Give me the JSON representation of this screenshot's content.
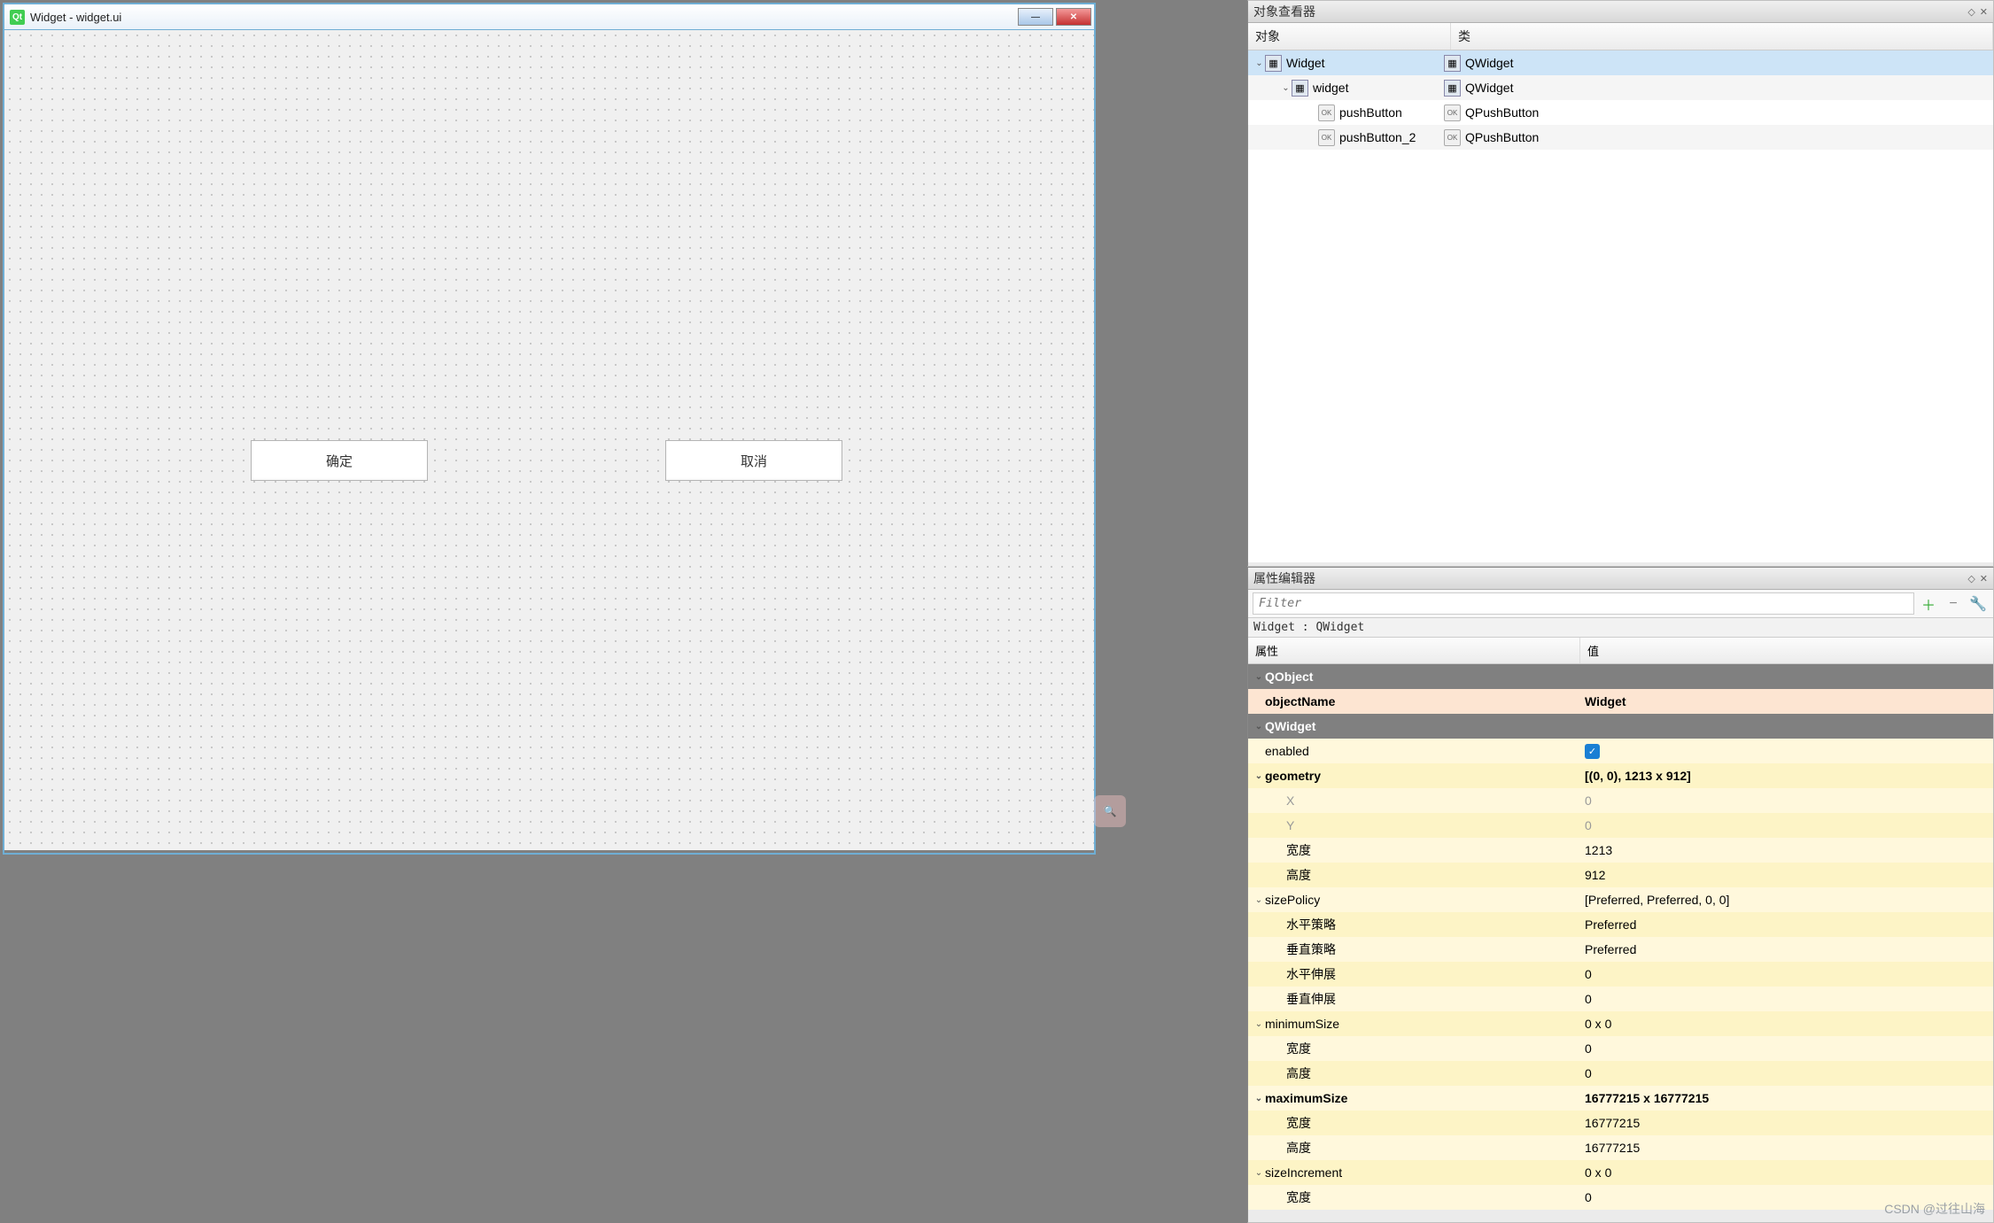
{
  "window": {
    "title": "Widget - widget.ui",
    "qt": "Qt"
  },
  "buttons": {
    "ok": "确定",
    "cancel": "取消"
  },
  "objectViewer": {
    "title": "对象查看器",
    "col1": "对象",
    "col2": "类",
    "rows": [
      {
        "name": "Widget",
        "cls": "QWidget",
        "indent": 0,
        "exp": true,
        "icon": "w",
        "sel": true
      },
      {
        "name": "widget",
        "cls": "QWidget",
        "indent": 1,
        "exp": true,
        "icon": "w",
        "alt": true
      },
      {
        "name": "pushButton",
        "cls": "QPushButton",
        "indent": 2,
        "icon": "b"
      },
      {
        "name": "pushButton_2",
        "cls": "QPushButton",
        "indent": 2,
        "icon": "b",
        "alt": true
      }
    ]
  },
  "propertyEditor": {
    "title": "属性编辑器",
    "filter": "Filter",
    "context": "Widget : QWidget",
    "col1": "属性",
    "col2": "值",
    "rows": [
      {
        "t": "g",
        "n": "QObject"
      },
      {
        "t": "p",
        "n": "objectName",
        "v": "Widget",
        "cls": "p bold",
        "ind": 1
      },
      {
        "t": "g",
        "n": "QWidget"
      },
      {
        "t": "p",
        "n": "enabled",
        "v": "",
        "chk": true,
        "cls": "y",
        "ind": 1
      },
      {
        "t": "p",
        "n": "geometry",
        "v": "[(0, 0), 1213 x 912]",
        "cls": "y2 bold",
        "ind": 1,
        "exp": true
      },
      {
        "t": "p",
        "n": "X",
        "v": "0",
        "cls": "y",
        "ind": 2,
        "dis": true
      },
      {
        "t": "p",
        "n": "Y",
        "v": "0",
        "cls": "y2",
        "ind": 2,
        "dis": true
      },
      {
        "t": "p",
        "n": "宽度",
        "v": "1213",
        "cls": "y",
        "ind": 2
      },
      {
        "t": "p",
        "n": "高度",
        "v": "912",
        "cls": "y2",
        "ind": 2
      },
      {
        "t": "p",
        "n": "sizePolicy",
        "v": "[Preferred, Preferred, 0, 0]",
        "cls": "y",
        "ind": 1,
        "exp": true
      },
      {
        "t": "p",
        "n": "水平策略",
        "v": "Preferred",
        "cls": "y2",
        "ind": 2
      },
      {
        "t": "p",
        "n": "垂直策略",
        "v": "Preferred",
        "cls": "y",
        "ind": 2
      },
      {
        "t": "p",
        "n": "水平伸展",
        "v": "0",
        "cls": "y2",
        "ind": 2
      },
      {
        "t": "p",
        "n": "垂直伸展",
        "v": "0",
        "cls": "y",
        "ind": 2
      },
      {
        "t": "p",
        "n": "minimumSize",
        "v": "0 x 0",
        "cls": "y2",
        "ind": 1,
        "exp": true
      },
      {
        "t": "p",
        "n": "宽度",
        "v": "0",
        "cls": "y",
        "ind": 2
      },
      {
        "t": "p",
        "n": "高度",
        "v": "0",
        "cls": "y2",
        "ind": 2
      },
      {
        "t": "p",
        "n": "maximumSize",
        "v": "16777215 x 16777215",
        "cls": "y bold",
        "ind": 1,
        "exp": true
      },
      {
        "t": "p",
        "n": "宽度",
        "v": "16777215",
        "cls": "y2",
        "ind": 2
      },
      {
        "t": "p",
        "n": "高度",
        "v": "16777215",
        "cls": "y",
        "ind": 2
      },
      {
        "t": "p",
        "n": "sizeIncrement",
        "v": "0 x 0",
        "cls": "y2",
        "ind": 1,
        "exp": true
      },
      {
        "t": "p",
        "n": "宽度",
        "v": "0",
        "cls": "y",
        "ind": 2
      }
    ]
  },
  "watermark": "CSDN @过往山海"
}
